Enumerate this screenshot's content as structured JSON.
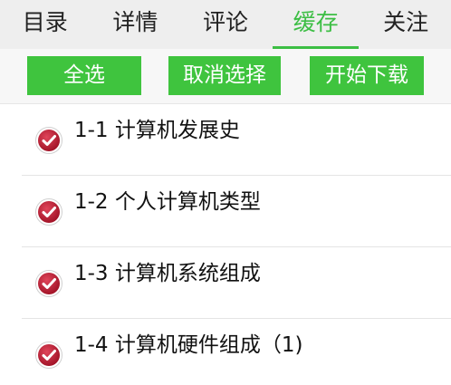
{
  "tabs": [
    {
      "label": "目录",
      "active": false
    },
    {
      "label": "详情",
      "active": false
    },
    {
      "label": "评论",
      "active": false
    },
    {
      "label": "缓存",
      "active": true
    },
    {
      "label": "关注",
      "active": false
    }
  ],
  "toolbar": {
    "select_all": "全选",
    "cancel_selection": "取消选择",
    "start_download": "开始下载"
  },
  "items": [
    {
      "title": "1-1 计算机发展史",
      "checked": true,
      "icon": "check-circle-icon"
    },
    {
      "title": "1-2 个人计算机类型",
      "checked": true,
      "icon": "check-circle-icon"
    },
    {
      "title": "1-3 计算机系统组成",
      "checked": true,
      "icon": "check-circle-icon"
    },
    {
      "title": "1-4 计算机硬件组成（1)",
      "checked": true,
      "icon": "check-circle-icon"
    }
  ],
  "colors": {
    "accent": "#3cbe44",
    "button": "#3fc43e",
    "check": "#c4223a"
  }
}
